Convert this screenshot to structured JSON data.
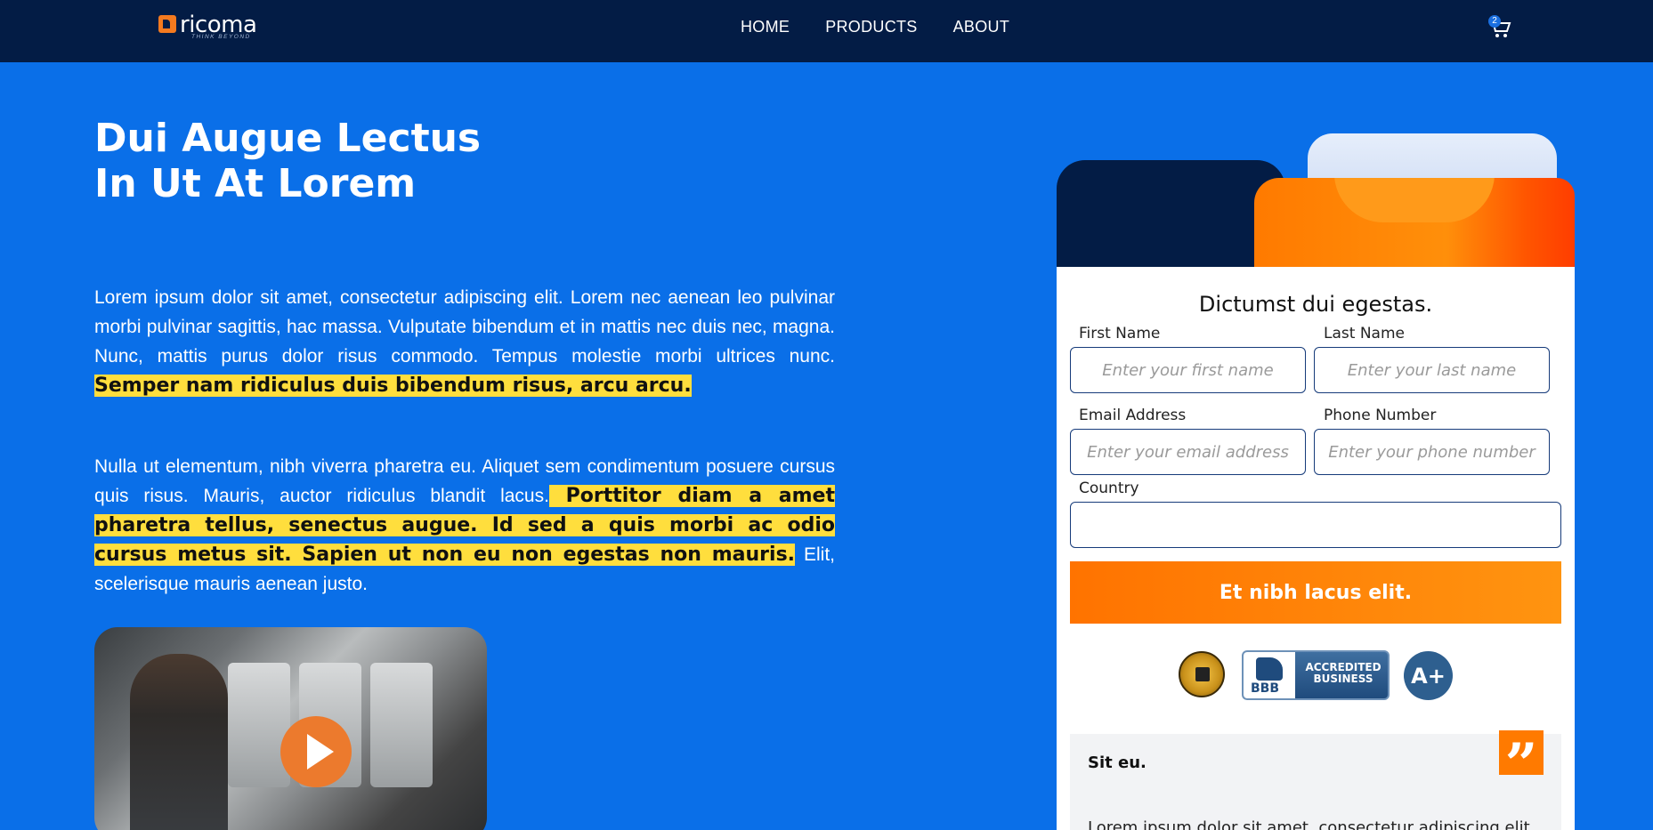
{
  "brand": {
    "name": "ricoma",
    "tagline": "THINK BEYOND",
    "accent": "#f47a1f",
    "nav_bg": "#031c45",
    "page_bg": "#0a6fe8"
  },
  "nav": {
    "items": [
      "HOME",
      "PRODUCTS",
      "ABOUT"
    ],
    "cart_count": "2"
  },
  "hero": {
    "title_line1": "Dui Augue Lectus",
    "title_line2": "In Ut At Lorem",
    "para1_plain": "Lorem ipsum dolor sit amet, consectetur adipiscing elit. Lorem nec aenean leo pulvinar morbi pulvinar sagittis, hac massa. Vulputate bibendum et in mattis nec duis nec, magna. Nunc, mattis purus dolor risus commodo. Tempus molestie morbi ultrices nunc. ",
    "para1_highlight": "Semper nam ridiculus duis bibendum risus, arcu arcu.",
    "para2_plain": "Nulla ut elementum, nibh viverra pharetra eu. Aliquet sem condimentum posuere cursus quis risus. Mauris, auctor ridiculus blandit lacus.",
    "para2_highlight": " Porttitor diam a amet pharetra tellus, senectus augue. Id sed a quis morbi ac odio cursus metus sit. Sapien ut non eu non egestas non mauris.",
    "para2_tail": " Elit, scelerisque mauris aenean justo."
  },
  "form": {
    "title": "Dictumst dui egestas.",
    "first_name_label": "First Name",
    "first_name_placeholder": "Enter your first name",
    "last_name_label": "Last Name",
    "last_name_placeholder": "Enter your last name",
    "email_label": "Email Address",
    "email_placeholder": "Enter your email address",
    "phone_label": "Phone Number",
    "phone_placeholder": "Enter your phone number",
    "country_label": "Country",
    "country_value": "",
    "submit_label": "Et nibh lacus elit."
  },
  "badges": {
    "bbb_logo": "BBB",
    "bbb_text": "ACCREDITED BUSINESS",
    "rating": "A+"
  },
  "testimonial": {
    "title": "Sit eu.",
    "text": "Lorem ipsum dolor sit amet, consectetur adipiscing elit.",
    "quote_icon": "quote-icon"
  }
}
